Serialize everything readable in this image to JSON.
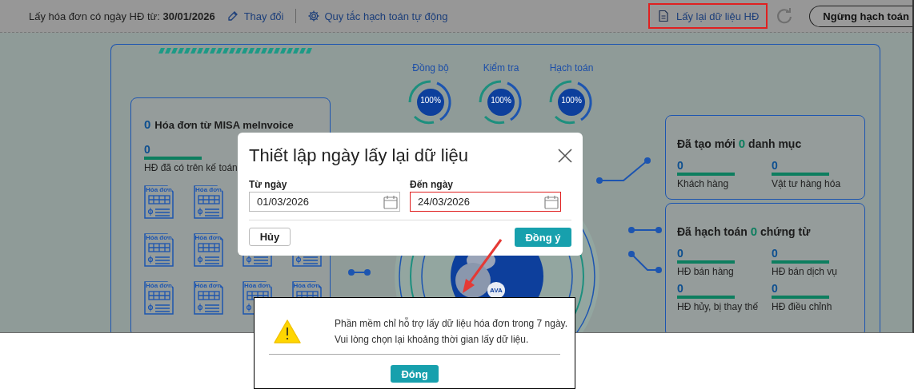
{
  "toolbar": {
    "date_filter": "Lấy hóa đơn có ngày HĐ từ: **30/01/2026**",
    "change_link": "Thay đổi",
    "rules_link": "Quy tắc hạch toán tự động",
    "reload_button": {
      "label": "Lấy lại dữ liệu HĐ",
      "highlighted": true
    },
    "stop_button": "Ngừng hạch toán"
  },
  "progress": [
    {
      "label": "Đồng bộ",
      "value": "100%"
    },
    {
      "label": "Kiểm tra",
      "value": "100%"
    },
    {
      "label": "Hạch toán",
      "value": "100%"
    }
  ],
  "invoice_card": {
    "count": "0",
    "title": "Hóa đơn từ MISA meInvoice",
    "stats": [
      {
        "value": "0",
        "label": "HĐ đã có trên kế toán"
      }
    ],
    "icon_rows": [
      [
        {
          "kind": "labelled",
          "label": "Hóa đơn"
        },
        {
          "kind": "labelled",
          "label": "Hóa đơn"
        }
      ],
      [
        {
          "kind": "labelled",
          "label": "Hóa đơn"
        },
        {
          "kind": "labelled",
          "label": "Hóa đơn"
        },
        {
          "kind": "plain"
        },
        {
          "kind": "plain"
        }
      ],
      [
        {
          "kind": "labelled",
          "label": "Hóa đơn"
        },
        {
          "kind": "labelled",
          "label": "Hóa đơn"
        },
        {
          "kind": "labelled",
          "label": "Hóa đơn"
        },
        {
          "kind": "labelled",
          "label": "Hóa đơn"
        }
      ]
    ]
  },
  "hub": {
    "label": "AVA"
  },
  "right_cards": [
    {
      "before": "Đã tạo mới",
      "count": "0",
      "after": "danh mục",
      "stats": [
        {
          "value": "0",
          "label": "Khách hàng"
        },
        {
          "value": "0",
          "label": "Vật tư hàng hóa"
        }
      ]
    },
    {
      "before": "Đã hạch toán",
      "count": "0",
      "after": "chứng từ",
      "stats": [
        {
          "value": "0",
          "label": "HĐ bán hàng"
        },
        {
          "value": "0",
          "label": "HĐ bán dịch vụ"
        },
        {
          "value": "0",
          "label": "HĐ hủy, bị thay thế"
        },
        {
          "value": "0",
          "label": "HĐ điều chỉnh"
        }
      ]
    }
  ],
  "dialog": {
    "title": "Thiết lập ngày lấy lại dữ liệu",
    "fields": [
      {
        "label": "Từ ngày",
        "value": "01/03/2026",
        "error": false
      },
      {
        "label": "Đến ngày",
        "value": "24/03/2026",
        "error": true
      }
    ],
    "cancel": "Hủy",
    "ok": "Đồng ý"
  },
  "warning": {
    "lines": [
      "Phần mềm chỉ hỗ trợ lấy dữ liệu hóa đơn trong 7 ngày.",
      "Vui lòng chọn lại khoảng thời gian lấy dữ liệu."
    ],
    "close": "Đóng"
  }
}
